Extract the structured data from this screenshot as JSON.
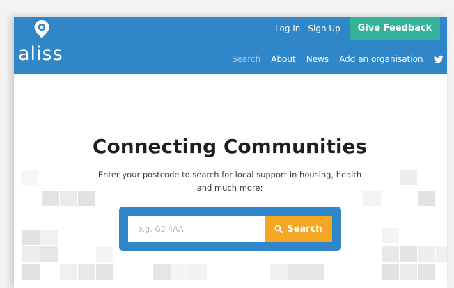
{
  "brand": {
    "name": "aliss"
  },
  "header": {
    "login_label": "Log In",
    "signup_label": "Sign Up",
    "feedback_label": "Give Feedback",
    "nav": {
      "search": "Search",
      "about": "About",
      "news": "News",
      "add_org": "Add an organisation"
    }
  },
  "hero": {
    "title": "Connecting Communities",
    "subtitle_line1": "Enter your postcode to search for local support in housing, health",
    "subtitle_line2": "and much more:"
  },
  "search": {
    "placeholder": "e.g. G2 4AA",
    "button_label": "Search"
  },
  "colors": {
    "header_bg": "#2f86c8",
    "feedback_bg": "#34b39a",
    "search_button": "#f5a623"
  },
  "icons": [
    "location-pin-icon",
    "twitter-icon",
    "search-icon"
  ]
}
